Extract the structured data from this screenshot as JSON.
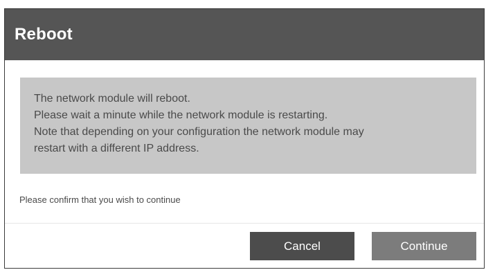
{
  "dialog": {
    "title": "Reboot",
    "notice_lines": [
      "The network module will reboot.",
      "Please wait a minute while the network module is restarting.",
      "Note that depending on your configuration the network module may",
      "restart with a different IP address."
    ],
    "confirm_text": "Please confirm that you wish to continue",
    "cancel_label": "Cancel",
    "continue_label": "Continue"
  },
  "colors": {
    "header_bg": "#555555",
    "notice_bg": "#c7c7c7",
    "cancel_bg": "#4c4c4c",
    "continue_bg": "#7c7c7c"
  }
}
